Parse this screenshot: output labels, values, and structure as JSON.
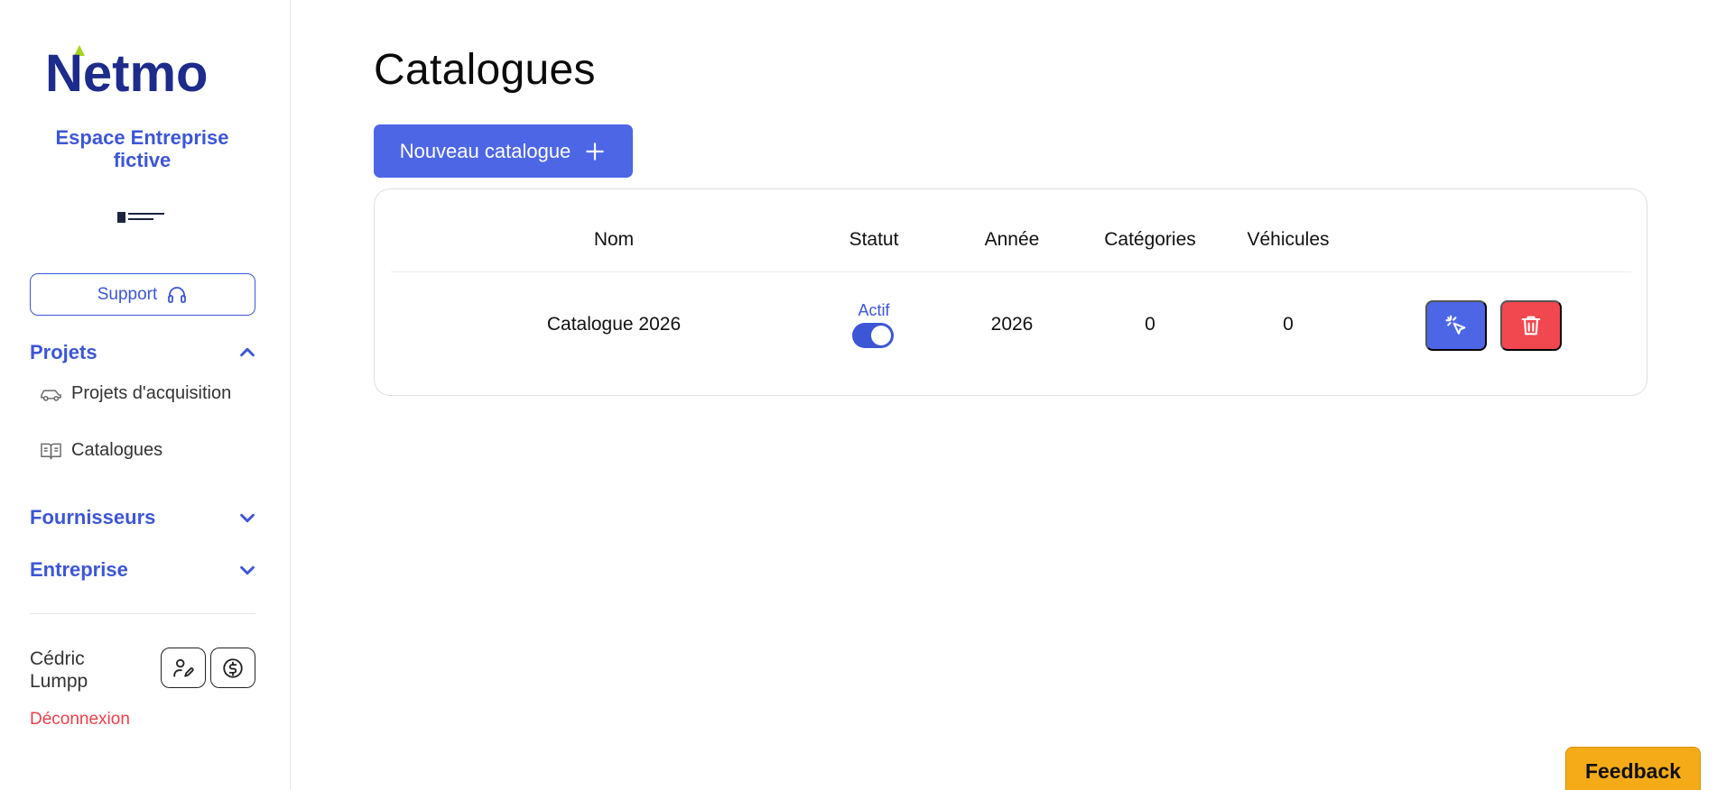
{
  "sidebar": {
    "logo_text": "Netmo",
    "company_name": "Espace Entreprise fictive",
    "company_logo_text": "ENTREPRISE FICTIVE",
    "support_label": "Support",
    "sections": {
      "projets": {
        "label": "Projets",
        "expanded": true
      },
      "fournisseurs": {
        "label": "Fournisseurs",
        "expanded": false
      },
      "entreprise": {
        "label": "Entreprise",
        "expanded": false
      }
    },
    "items": [
      {
        "label": "Projets d'acquisition",
        "icon": "car-icon"
      },
      {
        "label": "Catalogues",
        "icon": "book-icon"
      }
    ],
    "user": {
      "name": "Cédric Lumpp",
      "logout_label": "Déconnexion"
    }
  },
  "main": {
    "title": "Catalogues",
    "new_button_label": "Nouveau catalogue",
    "table": {
      "headers": {
        "nom": "Nom",
        "statut": "Statut",
        "annee": "Année",
        "categories": "Catégories",
        "vehicules": "Véhicules"
      },
      "rows": [
        {
          "nom": "Catalogue 2026",
          "statut": "Actif",
          "actif": true,
          "annee": "2026",
          "categories": "0",
          "vehicules": "0"
        }
      ]
    }
  },
  "feedback_label": "Feedback",
  "colors": {
    "accent": "#3c56d6",
    "primary_button": "#4d66e6",
    "danger": "#f1474e",
    "feedback": "#f5ab18",
    "logo_leaf": "#a7d41f"
  }
}
